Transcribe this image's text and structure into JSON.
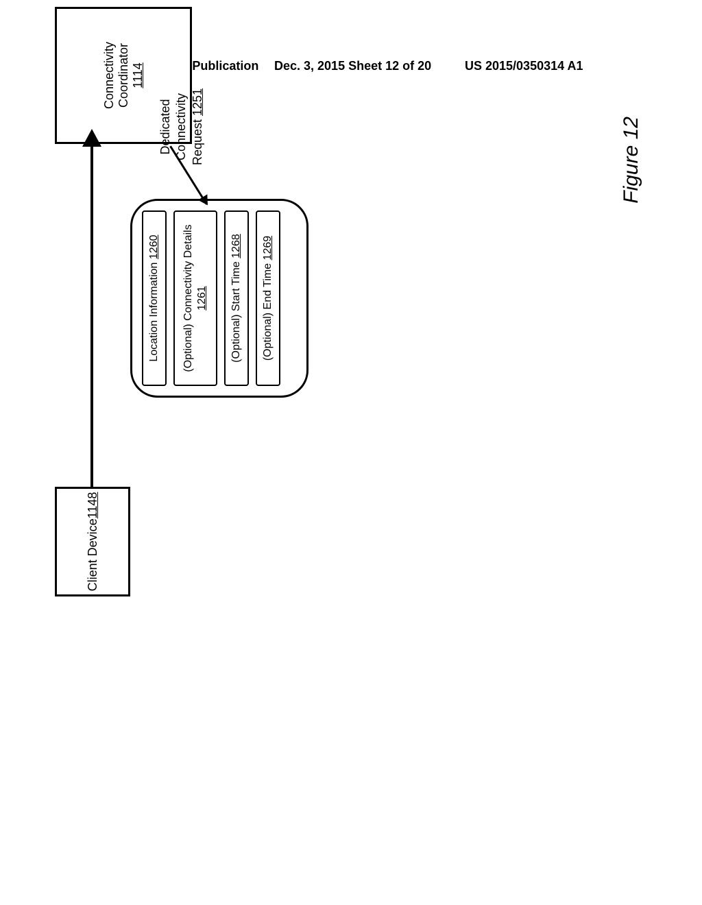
{
  "header": {
    "left": "Patent Application Publication",
    "middle": "Dec. 3, 2015   Sheet 12 of 20",
    "right": "US 2015/0350314 A1"
  },
  "figure_label": "Figure 12",
  "client_box": {
    "title": "Client Device",
    "ref": "1148"
  },
  "coord_box": {
    "line1": "Connectivity Coordinator",
    "ref": "1114"
  },
  "request_label": {
    "line1": "Dedicated",
    "line2": "Connectivity",
    "line3": "Request ",
    "ref": "1251"
  },
  "bubble": {
    "rows": [
      {
        "text": "Location Information ",
        "ref": "1260"
      },
      {
        "text": "(Optional) Connectivity Details ",
        "ref": "1261"
      },
      {
        "text": "(Optional) Start Time ",
        "ref": "1268"
      },
      {
        "text": "(Optional) End Time ",
        "ref": "1269"
      }
    ]
  }
}
